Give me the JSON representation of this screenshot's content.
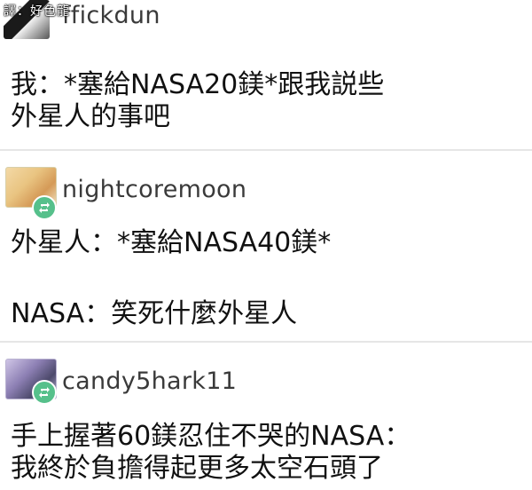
{
  "watermark": "譯：好色龍",
  "posts": [
    {
      "username": "ffickdun",
      "avatar": "black-and-white-figure-avatar",
      "lines": [
        "我：*塞給NASA20鎂*跟我説些",
        "外星人的事吧"
      ]
    },
    {
      "username": "nightcoremoon",
      "avatar": "anime-character-avatar",
      "badge_icon": "reblog-icon",
      "lines": [
        "外星人：*塞給NASA40鎂*",
        "NASA：笑死什麼外星人"
      ]
    },
    {
      "username": "candy5hark11",
      "avatar": "anime-character-avatar",
      "badge_icon": "reblog-icon",
      "lines": [
        "手上握著60鎂忍住不哭的NASA：",
        "我終於負擔得起更多太空石頭了"
      ]
    }
  ],
  "colors": {
    "background": "#ffffff",
    "text": "#111111",
    "username": "#3a3a3a",
    "reblog_badge": "#56c08b",
    "divider": "#e6e6e6"
  }
}
